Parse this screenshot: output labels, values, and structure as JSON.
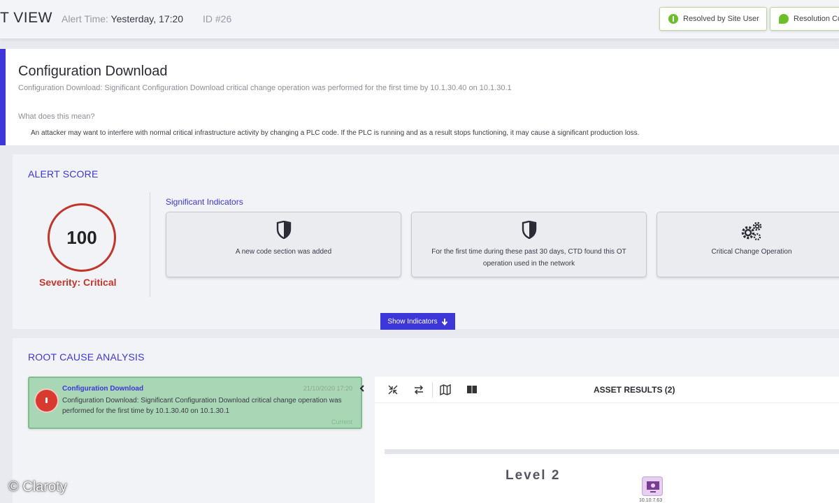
{
  "header": {
    "title": "T VIEW",
    "alert_time_label": "Alert Time:",
    "alert_time_value": "Yesterday, 17:20",
    "alert_id": "ID #26",
    "resolved_button": "Resolved by Site User",
    "resolution_button": "Resolution Co"
  },
  "description": {
    "title": "Configuration Download",
    "subtitle": "Configuration Download: Significant Configuration Download critical change operation was performed for the first time by 10.1.30.40 on 10.1.30.1",
    "question": "What does this mean?",
    "answer": "An attacker may want to interfere with normal critical infrastructure activity by changing a PLC code. If the PLC is running and as a result stops functioning, it may cause a significant production loss."
  },
  "alert_score": {
    "section_title": "ALERT SCORE",
    "score": "100",
    "severity": "Severity: Critical",
    "indicators_title": "Significant Indicators",
    "indicators": [
      {
        "icon": "shield-icon",
        "text": "A new code section was added"
      },
      {
        "icon": "shield-icon",
        "text": "For the first time during these past 30 days, CTD found this OT operation used in the network"
      },
      {
        "icon": "gears-icon",
        "text": "Critical Change Operation"
      }
    ],
    "show_button": "Show Indicators"
  },
  "root_cause": {
    "section_title": "ROOT CAUSE ANALYSIS",
    "event": {
      "title": "Configuration Download",
      "date": "21/10/2020 17:20",
      "description": "Configuration Download: Significant Configuration Download critical change operation was performed for the first time by 10.1.30.40 on 10.1.30.1",
      "status": "Current"
    },
    "asset_results_title": "ASSET RESULTS (2)",
    "level_label": "Level 2",
    "device_ip": "10.10.7.63"
  },
  "watermark": "© Claroty",
  "colors": {
    "accent": "#3d36d9",
    "critical": "#c2352b",
    "resolved_green": "#6cbf2a",
    "event_bg": "#a9d6b4"
  }
}
